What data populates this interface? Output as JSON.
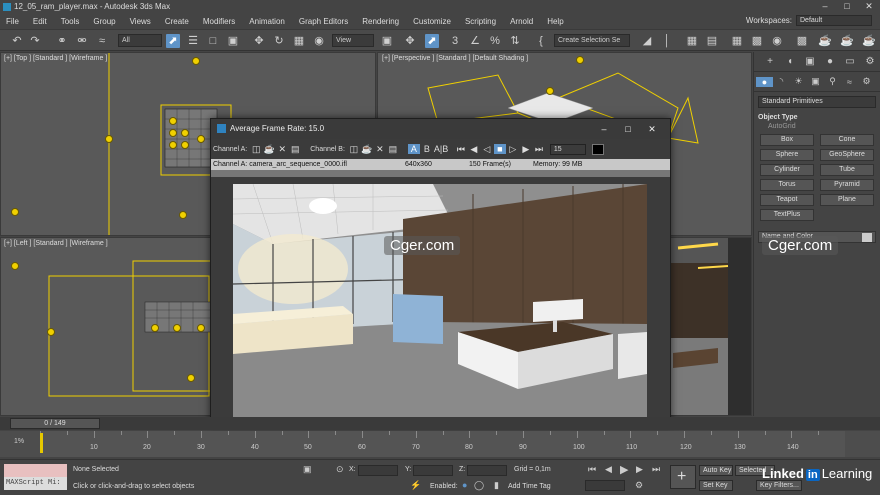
{
  "window": {
    "title": "12_05_ram_player.max - Autodesk 3ds Max"
  },
  "menu": {
    "items": [
      "File",
      "Edit",
      "Tools",
      "Group",
      "Views",
      "Create",
      "Modifiers",
      "Animation",
      "Graph Editors",
      "Rendering",
      "Customize",
      "Scripting",
      "Arnold",
      "Help"
    ],
    "workspaces_label": "Workspaces:",
    "workspaces_value": "Default"
  },
  "toolbar": {
    "filter_value": "All",
    "view_value": "View",
    "selection_set_placeholder": "Create Selection Se"
  },
  "viewports": {
    "top_label": "[+] [Top ] [Standard ] [Wireframe ]",
    "perspective_label": "[+] [Perspective ] [Standard ] [Default Shading ]",
    "left_label": "[+] [Left ] [Standard ] [Wireframe ]"
  },
  "command_panel": {
    "dropdown": "Standard Primitives",
    "rollout_title": "Object Type",
    "autogrid": "AutoGrid",
    "buttons": [
      "Box",
      "Cone",
      "Sphere",
      "GeoSphere",
      "Cylinder",
      "Tube",
      "Torus",
      "Pyramid",
      "Teapot",
      "Plane",
      "TextPlus"
    ],
    "name_color": "Name and Color"
  },
  "ram_player": {
    "title": "Average Frame Rate: 15.0",
    "channel_a_label": "Channel A:",
    "channel_b_label": "Channel B:",
    "btn_a": "A",
    "btn_b": "B",
    "btn_ab": "A|B",
    "fps_value": "15",
    "info_file": "Channel A: camera_arc_sequence_0000.ifl",
    "info_res": "640x360",
    "info_frames": "150 Frame(s)",
    "info_memory": "Memory: 99 MB"
  },
  "watermarks": [
    "Cger.com",
    "Cger.com"
  ],
  "timeline": {
    "slider_text": "0 / 149",
    "ticks": [
      "10",
      "20",
      "30",
      "40",
      "50",
      "60",
      "70",
      "80",
      "90",
      "100",
      "110",
      "120",
      "130",
      "140"
    ],
    "start_label": "1%"
  },
  "status": {
    "maxscript": "MAXScript Mi:",
    "selection": "None Selected",
    "prompt": "Click or click-and-drag to select objects",
    "x_label": "X:",
    "y_label": "Y:",
    "z_label": "Z:",
    "grid": "Grid = 0,1m",
    "enabled_label": "Enabled:",
    "add_time_tag": "Add Time Tag",
    "auto_key": "Auto Key",
    "selected": "Selected",
    "set_key": "Set Key",
    "key_filters": "Key Filters..."
  },
  "branding": {
    "linkedin": "Linked",
    "linkedin_in": "in",
    "learning": "Learning"
  }
}
